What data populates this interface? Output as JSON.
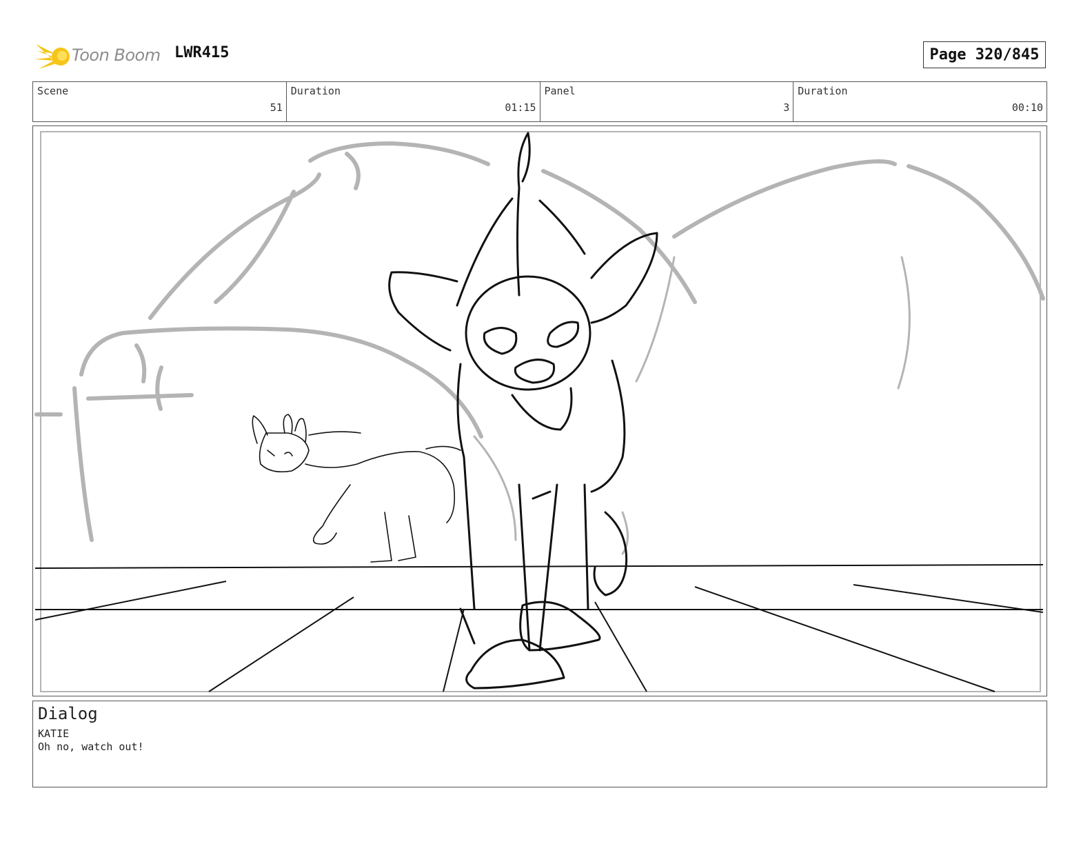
{
  "header": {
    "logo_text": "Toon Boom",
    "project_id": "LWR415",
    "page_label": "Page 320/845"
  },
  "info": {
    "scene_label": "Scene",
    "scene_value": "51",
    "scene_duration_label": "Duration",
    "scene_duration_value": "01:15",
    "panel_label": "Panel",
    "panel_value": "3",
    "panel_duration_label": "Duration",
    "panel_duration_value": "00:10"
  },
  "dialog": {
    "title": "Dialog",
    "speaker": "KATIE",
    "line": "Oh no, watch out!"
  },
  "colors": {
    "logo_accent": "#f5c518",
    "sketch_gray": "#b4b4b4",
    "sketch_ink": "#111111"
  }
}
